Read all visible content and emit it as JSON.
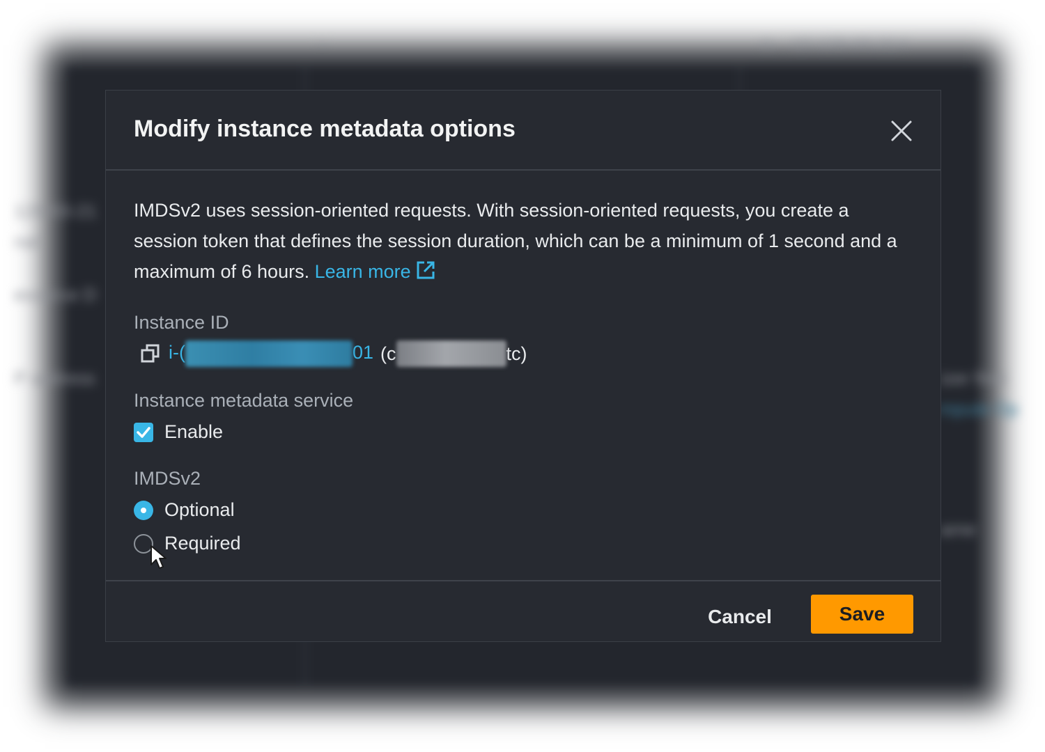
{
  "background": {
    "ip_address": "10.128.93.214",
    "dash": "–",
    "snippets": [
      "128-93-21",
      "nal",
      "esource D",
      "P address",
      "izer findi",
      "mpute Op",
      "ame"
    ]
  },
  "modal": {
    "title": "Modify instance metadata options",
    "description": "IMDSv2 uses session-oriented requests. With session-oriented requests, you create a session token that defines the session duration, which can be a minimum of 1 second and a maximum of 6 hours.",
    "learn_more": "Learn more",
    "instance_id_label": "Instance ID",
    "instance_id_prefix": "i-(",
    "instance_id_suffix": "01",
    "instance_name_open": "(c",
    "instance_name_close": "tc)",
    "metadata_service_label": "Instance metadata service",
    "enable_label": "Enable",
    "enable_checked": true,
    "imdsv2_label": "IMDSv2",
    "options": [
      {
        "label": "Optional",
        "selected": true
      },
      {
        "label": "Required",
        "selected": false
      }
    ],
    "cancel_label": "Cancel",
    "save_label": "Save"
  },
  "colors": {
    "accent": "#39b6e6",
    "primary_button": "#ff9900",
    "modal_bg": "#272a31"
  },
  "icons": [
    "close-icon",
    "external-link-icon",
    "copy-icon",
    "check-icon",
    "mouse-pointer-icon"
  ]
}
